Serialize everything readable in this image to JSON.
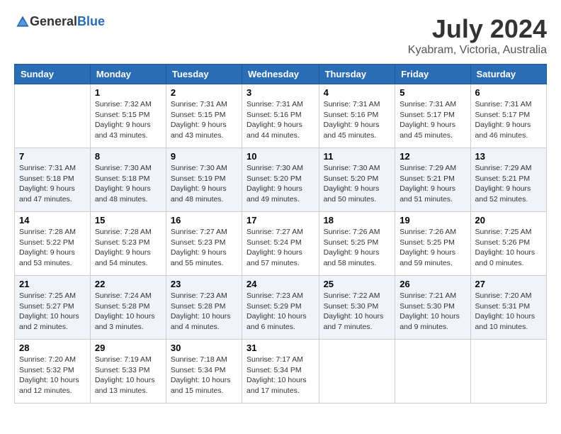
{
  "header": {
    "logo_general": "General",
    "logo_blue": "Blue",
    "month_year": "July 2024",
    "location": "Kyabram, Victoria, Australia"
  },
  "calendar": {
    "headers": [
      "Sunday",
      "Monday",
      "Tuesday",
      "Wednesday",
      "Thursday",
      "Friday",
      "Saturday"
    ],
    "weeks": [
      [
        {
          "day": "",
          "sunrise": "",
          "sunset": "",
          "daylight": ""
        },
        {
          "day": "1",
          "sunrise": "Sunrise: 7:32 AM",
          "sunset": "Sunset: 5:15 PM",
          "daylight": "Daylight: 9 hours and 43 minutes."
        },
        {
          "day": "2",
          "sunrise": "Sunrise: 7:31 AM",
          "sunset": "Sunset: 5:15 PM",
          "daylight": "Daylight: 9 hours and 43 minutes."
        },
        {
          "day": "3",
          "sunrise": "Sunrise: 7:31 AM",
          "sunset": "Sunset: 5:16 PM",
          "daylight": "Daylight: 9 hours and 44 minutes."
        },
        {
          "day": "4",
          "sunrise": "Sunrise: 7:31 AM",
          "sunset": "Sunset: 5:16 PM",
          "daylight": "Daylight: 9 hours and 45 minutes."
        },
        {
          "day": "5",
          "sunrise": "Sunrise: 7:31 AM",
          "sunset": "Sunset: 5:17 PM",
          "daylight": "Daylight: 9 hours and 45 minutes."
        },
        {
          "day": "6",
          "sunrise": "Sunrise: 7:31 AM",
          "sunset": "Sunset: 5:17 PM",
          "daylight": "Daylight: 9 hours and 46 minutes."
        }
      ],
      [
        {
          "day": "7",
          "sunrise": "Sunrise: 7:31 AM",
          "sunset": "Sunset: 5:18 PM",
          "daylight": "Daylight: 9 hours and 47 minutes."
        },
        {
          "day": "8",
          "sunrise": "Sunrise: 7:30 AM",
          "sunset": "Sunset: 5:18 PM",
          "daylight": "Daylight: 9 hours and 48 minutes."
        },
        {
          "day": "9",
          "sunrise": "Sunrise: 7:30 AM",
          "sunset": "Sunset: 5:19 PM",
          "daylight": "Daylight: 9 hours and 48 minutes."
        },
        {
          "day": "10",
          "sunrise": "Sunrise: 7:30 AM",
          "sunset": "Sunset: 5:20 PM",
          "daylight": "Daylight: 9 hours and 49 minutes."
        },
        {
          "day": "11",
          "sunrise": "Sunrise: 7:30 AM",
          "sunset": "Sunset: 5:20 PM",
          "daylight": "Daylight: 9 hours and 50 minutes."
        },
        {
          "day": "12",
          "sunrise": "Sunrise: 7:29 AM",
          "sunset": "Sunset: 5:21 PM",
          "daylight": "Daylight: 9 hours and 51 minutes."
        },
        {
          "day": "13",
          "sunrise": "Sunrise: 7:29 AM",
          "sunset": "Sunset: 5:21 PM",
          "daylight": "Daylight: 9 hours and 52 minutes."
        }
      ],
      [
        {
          "day": "14",
          "sunrise": "Sunrise: 7:28 AM",
          "sunset": "Sunset: 5:22 PM",
          "daylight": "Daylight: 9 hours and 53 minutes."
        },
        {
          "day": "15",
          "sunrise": "Sunrise: 7:28 AM",
          "sunset": "Sunset: 5:23 PM",
          "daylight": "Daylight: 9 hours and 54 minutes."
        },
        {
          "day": "16",
          "sunrise": "Sunrise: 7:27 AM",
          "sunset": "Sunset: 5:23 PM",
          "daylight": "Daylight: 9 hours and 55 minutes."
        },
        {
          "day": "17",
          "sunrise": "Sunrise: 7:27 AM",
          "sunset": "Sunset: 5:24 PM",
          "daylight": "Daylight: 9 hours and 57 minutes."
        },
        {
          "day": "18",
          "sunrise": "Sunrise: 7:26 AM",
          "sunset": "Sunset: 5:25 PM",
          "daylight": "Daylight: 9 hours and 58 minutes."
        },
        {
          "day": "19",
          "sunrise": "Sunrise: 7:26 AM",
          "sunset": "Sunset: 5:25 PM",
          "daylight": "Daylight: 9 hours and 59 minutes."
        },
        {
          "day": "20",
          "sunrise": "Sunrise: 7:25 AM",
          "sunset": "Sunset: 5:26 PM",
          "daylight": "Daylight: 10 hours and 0 minutes."
        }
      ],
      [
        {
          "day": "21",
          "sunrise": "Sunrise: 7:25 AM",
          "sunset": "Sunset: 5:27 PM",
          "daylight": "Daylight: 10 hours and 2 minutes."
        },
        {
          "day": "22",
          "sunrise": "Sunrise: 7:24 AM",
          "sunset": "Sunset: 5:28 PM",
          "daylight": "Daylight: 10 hours and 3 minutes."
        },
        {
          "day": "23",
          "sunrise": "Sunrise: 7:23 AM",
          "sunset": "Sunset: 5:28 PM",
          "daylight": "Daylight: 10 hours and 4 minutes."
        },
        {
          "day": "24",
          "sunrise": "Sunrise: 7:23 AM",
          "sunset": "Sunset: 5:29 PM",
          "daylight": "Daylight: 10 hours and 6 minutes."
        },
        {
          "day": "25",
          "sunrise": "Sunrise: 7:22 AM",
          "sunset": "Sunset: 5:30 PM",
          "daylight": "Daylight: 10 hours and 7 minutes."
        },
        {
          "day": "26",
          "sunrise": "Sunrise: 7:21 AM",
          "sunset": "Sunset: 5:30 PM",
          "daylight": "Daylight: 10 hours and 9 minutes."
        },
        {
          "day": "27",
          "sunrise": "Sunrise: 7:20 AM",
          "sunset": "Sunset: 5:31 PM",
          "daylight": "Daylight: 10 hours and 10 minutes."
        }
      ],
      [
        {
          "day": "28",
          "sunrise": "Sunrise: 7:20 AM",
          "sunset": "Sunset: 5:32 PM",
          "daylight": "Daylight: 10 hours and 12 minutes."
        },
        {
          "day": "29",
          "sunrise": "Sunrise: 7:19 AM",
          "sunset": "Sunset: 5:33 PM",
          "daylight": "Daylight: 10 hours and 13 minutes."
        },
        {
          "day": "30",
          "sunrise": "Sunrise: 7:18 AM",
          "sunset": "Sunset: 5:34 PM",
          "daylight": "Daylight: 10 hours and 15 minutes."
        },
        {
          "day": "31",
          "sunrise": "Sunrise: 7:17 AM",
          "sunset": "Sunset: 5:34 PM",
          "daylight": "Daylight: 10 hours and 17 minutes."
        },
        {
          "day": "",
          "sunrise": "",
          "sunset": "",
          "daylight": ""
        },
        {
          "day": "",
          "sunrise": "",
          "sunset": "",
          "daylight": ""
        },
        {
          "day": "",
          "sunrise": "",
          "sunset": "",
          "daylight": ""
        }
      ]
    ]
  }
}
